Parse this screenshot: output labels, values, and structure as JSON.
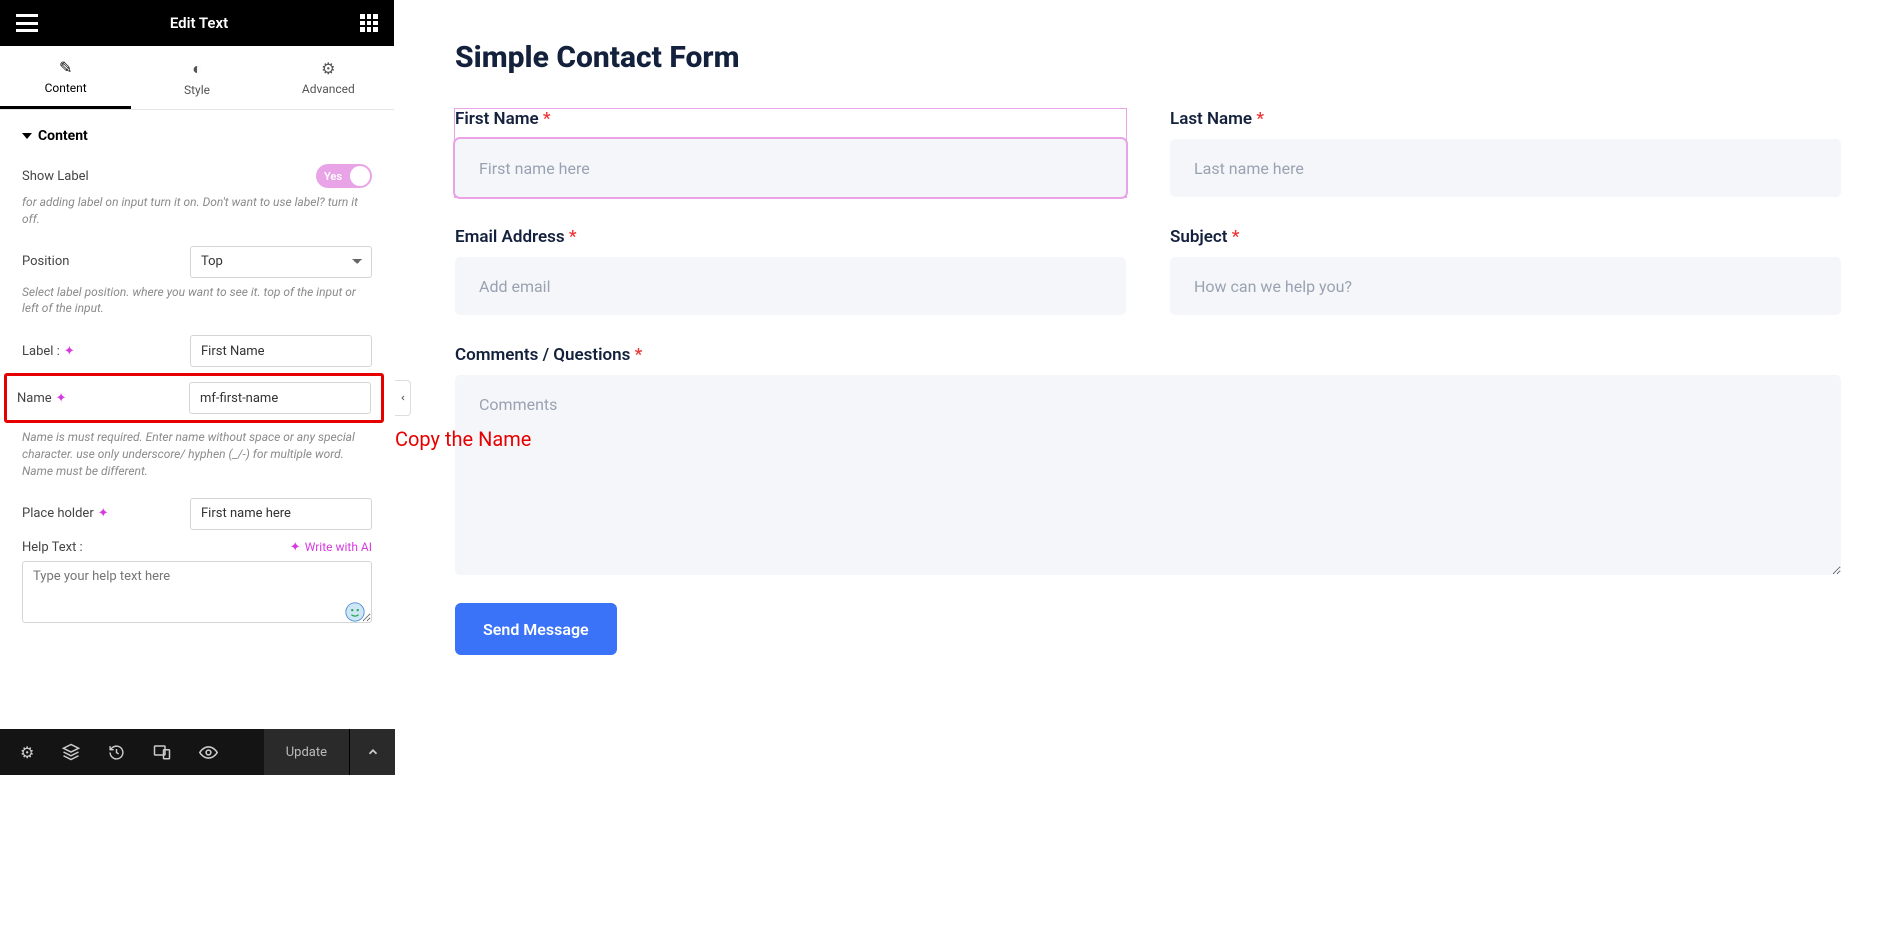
{
  "header": {
    "title": "Edit Text"
  },
  "tabs": {
    "content": "Content",
    "style": "Style",
    "advanced": "Advanced"
  },
  "section": {
    "title": "Content",
    "show_label": {
      "label": "Show Label",
      "value": "Yes",
      "hint": "for adding label on input turn it on. Don't want to use label? turn it off."
    },
    "position": {
      "label": "Position",
      "value": "Top",
      "hint": "Select label position. where you want to see it. top of the input or left of the input."
    },
    "label_field": {
      "label": "Label :",
      "value": "First Name"
    },
    "name_field": {
      "label": "Name",
      "value": "mf-first-name",
      "hint": "Name is must required. Enter name without space or any special character. use only underscore/ hyphen (_/-) for multiple word. Name must be different."
    },
    "placeholder": {
      "label": "Place holder",
      "value": "First name here"
    },
    "help_text": {
      "label": "Help Text :",
      "ai_link": "Write with AI",
      "placeholder": "Type your help text here"
    }
  },
  "footer": {
    "update": "Update"
  },
  "annotation": "Copy the Name",
  "form": {
    "title": "Simple Contact Form",
    "first_name": {
      "label": "First Name",
      "placeholder": "First name here"
    },
    "last_name": {
      "label": "Last Name",
      "placeholder": "Last name here"
    },
    "email": {
      "label": "Email Address",
      "placeholder": "Add email"
    },
    "subject": {
      "label": "Subject",
      "placeholder": "How can we help you?"
    },
    "comments": {
      "label": "Comments / Questions",
      "placeholder": "Comments"
    },
    "submit": "Send Message"
  }
}
